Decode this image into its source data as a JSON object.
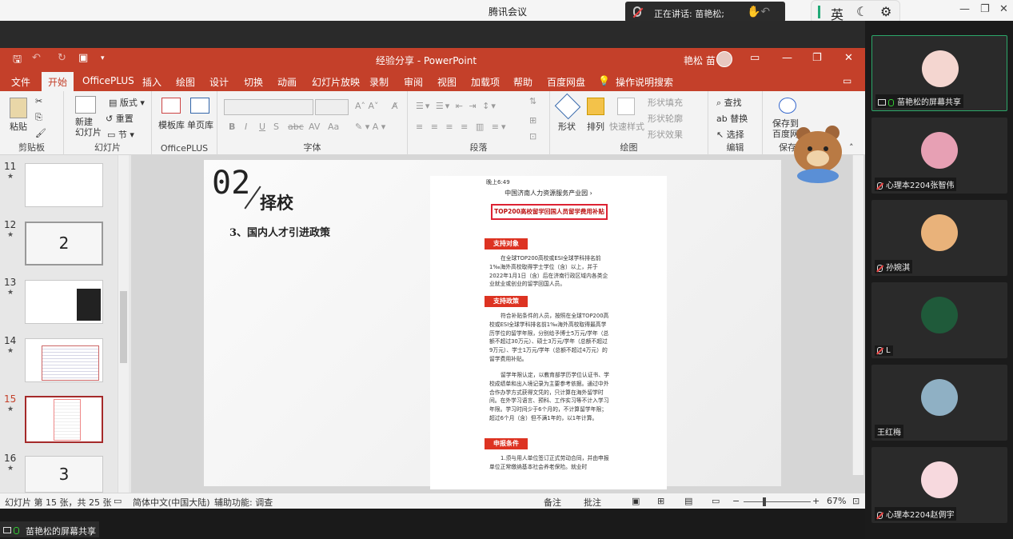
{
  "meeting_title": "腾讯会议",
  "speaking": "正在讲话: 苗艳松;",
  "ime": {
    "mode": "英"
  },
  "ppt": {
    "doc_title": "经验分享 - PowerPoint",
    "user": "艳松 苗",
    "tabs": [
      "文件",
      "开始",
      "OfficePLUS",
      "插入",
      "绘图",
      "设计",
      "切换",
      "动画",
      "幻灯片放映",
      "录制",
      "审阅",
      "视图",
      "加载项",
      "帮助",
      "百度网盘"
    ],
    "tell_me": "操作说明搜索",
    "groups": {
      "clipboard": {
        "label": "剪贴板",
        "paste": "粘贴"
      },
      "slides": {
        "label": "幻灯片",
        "new_slide": "新建\n幻灯片",
        "layout": "版式",
        "reset": "重置",
        "section": "节"
      },
      "officeplus": {
        "label": "OfficePLUS",
        "template": "模板库",
        "single": "单页库"
      },
      "font": {
        "label": "字体",
        "bold": "B",
        "italic": "I",
        "underline": "U",
        "shadow": "S",
        "strike": "abc",
        "spacing": "AV",
        "case": "Aa"
      },
      "paragraph": {
        "label": "段落"
      },
      "drawing": {
        "label": "绘图",
        "shape": "形状",
        "arrange": "排列",
        "quick_style": "快速样式",
        "fill": "形状填充",
        "outline": "形状轮廓",
        "effect": "形状效果"
      },
      "editing": {
        "label": "编辑",
        "find": "查找",
        "replace": "替换",
        "select": "选择"
      },
      "save": {
        "label": "保存",
        "save_to": "保存到\n百度网盘"
      }
    },
    "thumbnails": [
      {
        "num": "11",
        "selected": false
      },
      {
        "num": "12",
        "selected": false,
        "text": "2"
      },
      {
        "num": "13",
        "selected": false
      },
      {
        "num": "14",
        "selected": false
      },
      {
        "num": "15",
        "selected": true
      },
      {
        "num": "16",
        "selected": false,
        "text": "3"
      }
    ],
    "slide": {
      "number": "02",
      "heading": "择校",
      "subheading": "3、国内人才引进政策",
      "phone": {
        "statusbar": "晚上6:49",
        "nav_title": "中国济南人力资源服务产业园 ›",
        "banner": "TOP200高校留学回国人员留学费用补贴",
        "sections": [
          {
            "tag": "支持对象",
            "text": "在全球TOP200高校或ESI全球学科排名前1‰海外高校取得学士学位（含）以上，并于2022年1月1日（含）后在济南行政区域内各类企业就业或创业的留学回国人员。"
          },
          {
            "tag": "支持政策",
            "text": "符合补贴条件的人员，按照在全球TOP200高校或ESI全球学科排名前1‰海外高校取得最高学历学位的留学年限，分别给予博士5万元/学年（总额不超过30万元）、硕士3万元/学年（总额不超过9万元）、学士1万元/学年（总额不超过4万元）的留学费用补贴。",
            "text2": "留学年限认定，以教育部学历学位认证书、学校成绩单和出入境记录为主要参考依据。通过中外合作办学方式获得文凭的，只计算在海外留学时间。在外学习语言、预科、工作实习等不计入学习年限。学习时间少于6个月的，不计算留学年限；超过6个月（含）但不满1年的，以1年计算。"
          },
          {
            "tag": "申报条件",
            "text": "1.须与用人单位签订正式劳动合同，并由申报单位正常缴纳基本社会养老保险。就业时"
          }
        ]
      }
    },
    "status": {
      "slide_info": "幻灯片 第 15 张，共 25 张",
      "language": "简体中文(中国大陆)",
      "accessibility": "辅助功能: 调查",
      "notes": "备注",
      "comments": "批注",
      "zoom": "67%"
    }
  },
  "share_pill": "苗艳松的屏幕共享",
  "participants": [
    {
      "name": "苗艳松的屏幕共享",
      "icon": "screen",
      "color": "#f4d6d0"
    },
    {
      "name": "心理本2204张智伟",
      "icon": "mic-off",
      "color": "#e7a0b4"
    },
    {
      "name": "孙婉淇",
      "icon": "mic-off",
      "color": "#e9b27a"
    },
    {
      "name": "L",
      "icon": "mic-off",
      "color": "#1f5a3a"
    },
    {
      "name": "王红梅",
      "icon": "none",
      "color": "#8fb0c4"
    },
    {
      "name": "心理本2204赵倜宇",
      "icon": "mic-off",
      "color": "#f7d9de"
    }
  ]
}
